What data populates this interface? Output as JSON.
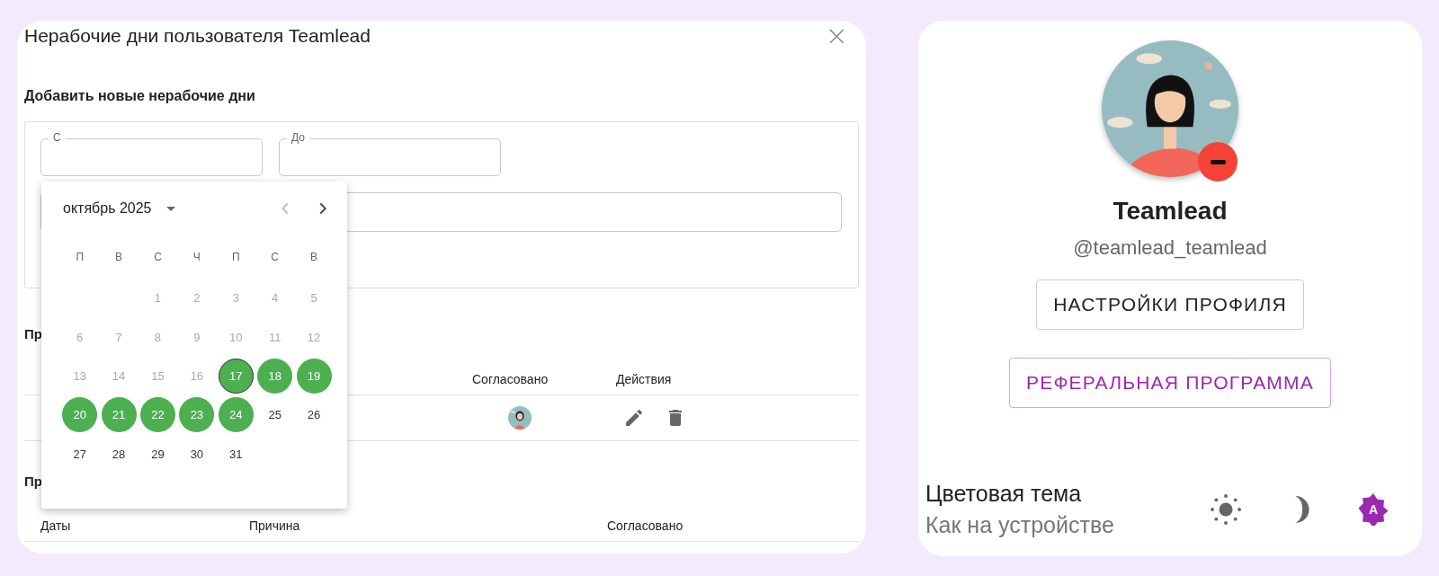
{
  "dialog": {
    "title": "Нерабочие дни пользователя Teamlead",
    "close": "×",
    "add_section": {
      "heading": "Добавить новые нерабочие дни",
      "fields": [
        {
          "label": "С"
        },
        {
          "label": "До"
        }
      ]
    },
    "date_picker": {
      "month": "октябрь 2025",
      "weekdays": [
        "П",
        "В",
        "С",
        "Ч",
        "П",
        "С",
        "В"
      ],
      "weeks": [
        [
          {
            "kind": "blank"
          },
          {
            "kind": "blank"
          },
          {
            "kind": "day",
            "label": "1",
            "selected": false,
            "disabled": true,
            "today": false
          },
          {
            "kind": "day",
            "label": "2",
            "selected": false,
            "disabled": true,
            "today": false
          },
          {
            "kind": "day",
            "label": "3",
            "selected": false,
            "disabled": true,
            "today": false
          },
          {
            "kind": "day",
            "label": "4",
            "selected": false,
            "disabled": true,
            "today": false
          },
          {
            "kind": "day",
            "label": "5",
            "selected": false,
            "disabled": true,
            "today": false
          }
        ],
        [
          {
            "kind": "day",
            "label": "6",
            "selected": false,
            "disabled": true,
            "today": false
          },
          {
            "kind": "day",
            "label": "7",
            "selected": false,
            "disabled": true,
            "today": false
          },
          {
            "kind": "day",
            "label": "8",
            "selected": false,
            "disabled": true,
            "today": false
          },
          {
            "kind": "day",
            "label": "9",
            "selected": false,
            "disabled": true,
            "today": false
          },
          {
            "kind": "day",
            "label": "10",
            "selected": false,
            "disabled": true,
            "today": false
          },
          {
            "kind": "day",
            "label": "11",
            "selected": false,
            "disabled": true,
            "today": false
          },
          {
            "kind": "day",
            "label": "12",
            "selected": false,
            "disabled": true,
            "today": false
          }
        ],
        [
          {
            "kind": "day",
            "label": "13",
            "selected": false,
            "disabled": true,
            "today": false
          },
          {
            "kind": "day",
            "label": "14",
            "selected": false,
            "disabled": true,
            "today": false
          },
          {
            "kind": "day",
            "label": "15",
            "selected": false,
            "disabled": true,
            "today": false
          },
          {
            "kind": "day",
            "label": "16",
            "selected": false,
            "disabled": true,
            "today": false
          },
          {
            "kind": "day",
            "label": "17",
            "selected": true,
            "disabled": false,
            "today": true
          },
          {
            "kind": "day",
            "label": "18",
            "selected": true,
            "disabled": false,
            "today": false
          },
          {
            "kind": "day",
            "label": "19",
            "selected": true,
            "disabled": false,
            "today": false
          }
        ],
        [
          {
            "kind": "day",
            "label": "20",
            "selected": true,
            "disabled": false,
            "today": false
          },
          {
            "kind": "day",
            "label": "21",
            "selected": true,
            "disabled": false,
            "today": false
          },
          {
            "kind": "day",
            "label": "22",
            "selected": true,
            "disabled": false,
            "today": false
          },
          {
            "kind": "day",
            "label": "23",
            "selected": true,
            "disabled": false,
            "today": false
          },
          {
            "kind": "day",
            "label": "24",
            "selected": true,
            "disabled": false,
            "today": false
          },
          {
            "kind": "day",
            "label": "25",
            "selected": false,
            "disabled": false,
            "today": false
          },
          {
            "kind": "day",
            "label": "26",
            "selected": false,
            "disabled": false,
            "today": false
          }
        ],
        [
          {
            "kind": "day",
            "label": "27",
            "selected": false,
            "disabled": false,
            "today": false
          },
          {
            "kind": "day",
            "label": "28",
            "selected": false,
            "disabled": false,
            "today": false
          },
          {
            "kind": "day",
            "label": "29",
            "selected": false,
            "disabled": false,
            "today": false
          },
          {
            "kind": "day",
            "label": "30",
            "selected": false,
            "disabled": false,
            "today": false
          },
          {
            "kind": "day",
            "label": "31",
            "selected": false,
            "disabled": false,
            "today": false
          }
        ]
      ]
    },
    "upcoming": {
      "heading": "Пр",
      "columns": [
        "Согласовано",
        "Действия"
      ],
      "rows": [
        {
          "approved": {
            "kind": "picture"
          },
          "actions": [
            {
              "kind": "edit"
            },
            {
              "kind": "delete"
            }
          ]
        }
      ]
    },
    "past": {
      "heading": "Пр",
      "columns": [
        "Даты",
        "Причина",
        "Согласовано"
      ]
    }
  },
  "profile": {
    "name": "Teamlead",
    "handle": "@teamlead_teamlead",
    "busy": true,
    "buttons": [
      {
        "label": "НАСТРОЙКИ ПРОФИЛЯ",
        "kind": "default"
      },
      {
        "label": "РЕФЕРАЛЬНАЯ ПРОГРАММА",
        "kind": "primary"
      }
    ],
    "theme": {
      "label": "Цветовая тема",
      "value": "Как на устройстве",
      "options": [
        {
          "kind": "light",
          "selected": false
        },
        {
          "kind": "dark",
          "selected": false
        },
        {
          "kind": "auto",
          "label": "A",
          "selected": true
        }
      ]
    }
  }
}
